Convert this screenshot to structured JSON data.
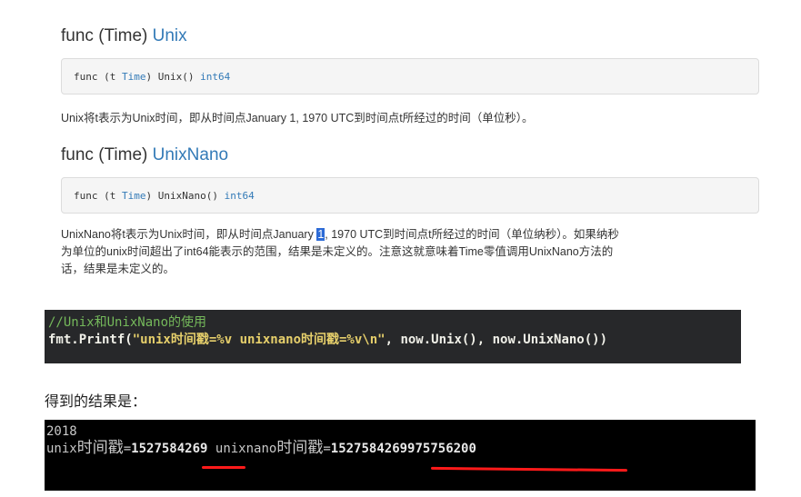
{
  "sections": [
    {
      "heading_prefix": "func (Time) ",
      "heading_link": "Unix",
      "signature_prefix": "func (t ",
      "signature_type": "Time",
      "signature_mid": ") Unix() ",
      "signature_ret": "int64",
      "description": "Unix将t表示为Unix时间，即从时间点January 1, 1970 UTC到时间点t所经过的时间（单位秒）。"
    },
    {
      "heading_prefix": "func (Time) ",
      "heading_link": "UnixNano",
      "signature_prefix": "func (t ",
      "signature_type": "Time",
      "signature_mid": ") UnixNano() ",
      "signature_ret": "int64",
      "description_line1_a": "UnixNano将t表示为Unix时间，即从时间点January ",
      "description_line1_sel": "1",
      "description_line1_b": ", 1970 UTC到时间点t所经过的时间（单位纳秒）。如果纳秒",
      "description_line2": "为单位的unix时间超出了int64能表示的范围，结果是未定义的。注意这就意味着Time零值调用UnixNano方法的",
      "description_line3": "话，结果是未定义的。"
    }
  ],
  "snippet": {
    "comment": "//Unix和UnixNano的使用",
    "code_prefix": "fmt.Printf(",
    "code_string": "\"unix时间戳=%v unixnano时间戳=%v\\n\"",
    "code_suffix": ", now.Unix(), now.UnixNano())"
  },
  "result_label": "得到的结果是：",
  "console": {
    "line1": "2018",
    "unix_label_a": "unix",
    "unix_label_b": "时间戳",
    "unix_eq": "=",
    "unix_value": "1527584269",
    "nano_label_a": "unixnano",
    "nano_label_b": "时间戳",
    "nano_eq": "=",
    "nano_value": "1527584269975756200"
  },
  "colors": {
    "link": "#337ab7",
    "underline": "#ff1a1a"
  }
}
